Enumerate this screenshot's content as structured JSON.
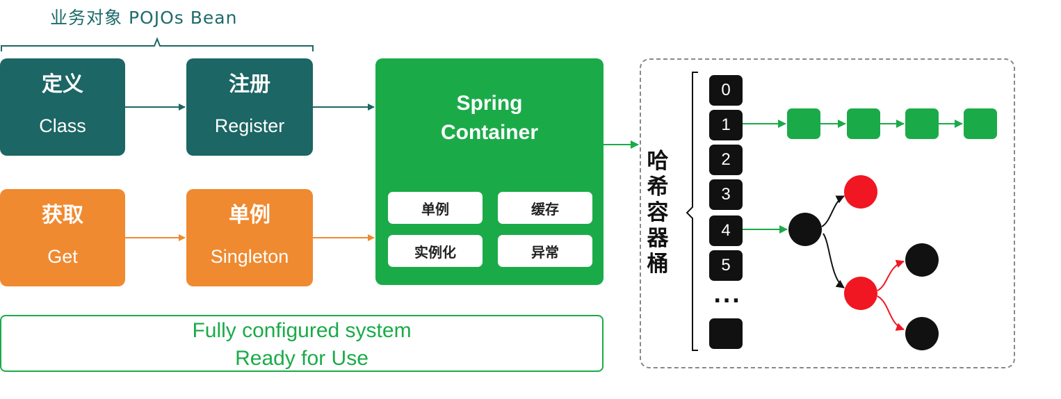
{
  "header": {
    "title": "业务对象 POJOs Bean"
  },
  "steps": {
    "define": {
      "cn": "定义",
      "en": "Class"
    },
    "register": {
      "cn": "注册",
      "en": "Register"
    },
    "get": {
      "cn": "获取",
      "en": "Get"
    },
    "singleton": {
      "cn": "单例",
      "en": "Singleton"
    }
  },
  "container": {
    "title_line1": "Spring",
    "title_line2": "Container",
    "features": [
      "单例",
      "缓存",
      "实例化",
      "异常"
    ]
  },
  "footer": {
    "line1": "Fully configured system",
    "line2": "Ready for Use"
  },
  "hash": {
    "label_chars": [
      "哈",
      "希",
      "容",
      "器",
      "桶"
    ],
    "buckets": [
      "0",
      "1",
      "2",
      "3",
      "4",
      "5",
      ""
    ],
    "ellipsis": "..."
  },
  "colors": {
    "teal": "#1c6665",
    "orange": "#ef8a30",
    "green": "#1aab48",
    "red": "#f01722",
    "black": "#111111"
  }
}
